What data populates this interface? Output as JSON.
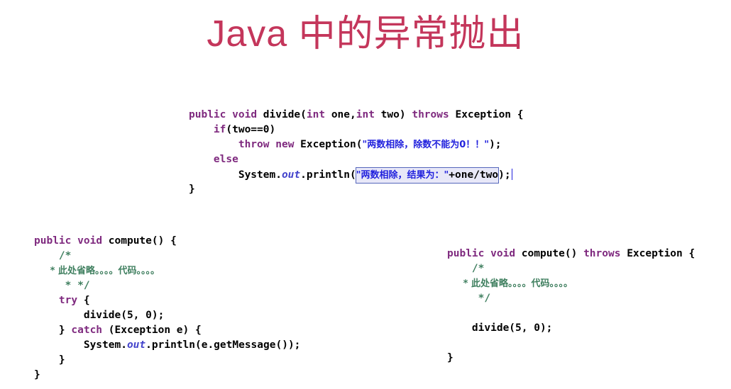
{
  "slide": {
    "title": "Java 中的异常抛出",
    "title_color": "#c4365b",
    "background_color": "#ffffff"
  },
  "theme": {
    "keyword_color": "#7f2a7f",
    "string_color": "#2222dd",
    "comment_color": "#3f7f5f",
    "field_color": "#4444cc",
    "plain_color": "#000000",
    "selection_fill": "#e8e8f8",
    "selection_border": "#5566bb"
  },
  "code_divide": {
    "name": "divide-method-snippet",
    "lines": [
      {
        "tokens": [
          {
            "t": "public",
            "k": "kw"
          },
          {
            "t": " ",
            "k": "plain"
          },
          {
            "t": "void",
            "k": "kw"
          },
          {
            "t": " divide(",
            "k": "plain"
          },
          {
            "t": "int",
            "k": "kw"
          },
          {
            "t": " one,",
            "k": "plain"
          },
          {
            "t": "int",
            "k": "kw"
          },
          {
            "t": " two) ",
            "k": "plain"
          },
          {
            "t": "throws",
            "k": "kw"
          },
          {
            "t": " Exception {",
            "k": "plain"
          }
        ]
      },
      {
        "tokens": [
          {
            "t": "    ",
            "k": "plain"
          },
          {
            "t": "if",
            "k": "kw"
          },
          {
            "t": "(two==0)",
            "k": "plain"
          }
        ]
      },
      {
        "tokens": [
          {
            "t": "        ",
            "k": "plain"
          },
          {
            "t": "throw",
            "k": "kw"
          },
          {
            "t": " ",
            "k": "plain"
          },
          {
            "t": "new",
            "k": "kw"
          },
          {
            "t": " Exception(",
            "k": "plain"
          },
          {
            "t": "\"两数相除，除数不能为0！！\"",
            "k": "str"
          },
          {
            "t": ");",
            "k": "plain"
          }
        ]
      },
      {
        "tokens": [
          {
            "t": "    ",
            "k": "plain"
          },
          {
            "t": "else",
            "k": "kw"
          }
        ]
      },
      {
        "tokens": [
          {
            "t": "        System.",
            "k": "plain"
          },
          {
            "t": "out",
            "k": "field"
          },
          {
            "t": ".println(",
            "k": "plain"
          },
          {
            "t": "\"两数相除，结果为：\"",
            "k": "str",
            "sel": "open"
          },
          {
            "t": "+one/two",
            "k": "plain",
            "sel": "close"
          },
          {
            "t": ");",
            "k": "plain"
          },
          {
            "t": "",
            "k": "caret"
          }
        ]
      },
      {
        "tokens": [
          {
            "t": "}",
            "k": "plain"
          }
        ]
      }
    ]
  },
  "code_compute_try": {
    "name": "compute-with-try-catch-snippet",
    "lines": [
      {
        "tokens": [
          {
            "t": "public",
            "k": "kw"
          },
          {
            "t": " ",
            "k": "plain"
          },
          {
            "t": "void",
            "k": "kw"
          },
          {
            "t": " compute() {",
            "k": "plain"
          }
        ]
      },
      {
        "tokens": [
          {
            "t": "    /*",
            "k": "cmt"
          }
        ]
      },
      {
        "tokens": [
          {
            "t": "     * 此处省略。。。。代码。。。。",
            "k": "cmt"
          }
        ]
      },
      {
        "tokens": [
          {
            "t": "     * */",
            "k": "cmt"
          }
        ]
      },
      {
        "tokens": [
          {
            "t": "    ",
            "k": "plain"
          },
          {
            "t": "try",
            "k": "kw"
          },
          {
            "t": " {",
            "k": "plain"
          }
        ]
      },
      {
        "tokens": [
          {
            "t": "        divide(5, 0);",
            "k": "plain"
          }
        ]
      },
      {
        "tokens": [
          {
            "t": "    } ",
            "k": "plain"
          },
          {
            "t": "catch",
            "k": "kw"
          },
          {
            "t": " (Exception e) {",
            "k": "plain"
          }
        ]
      },
      {
        "tokens": [
          {
            "t": "        System.",
            "k": "plain"
          },
          {
            "t": "out",
            "k": "field"
          },
          {
            "t": ".println(e.getMessage());",
            "k": "plain"
          }
        ]
      },
      {
        "tokens": [
          {
            "t": "    }",
            "k": "plain"
          }
        ]
      },
      {
        "tokens": [
          {
            "t": "}",
            "k": "plain"
          }
        ]
      }
    ]
  },
  "code_compute_throws": {
    "name": "compute-with-throws-snippet",
    "lines": [
      {
        "tokens": [
          {
            "t": "public",
            "k": "kw"
          },
          {
            "t": " ",
            "k": "plain"
          },
          {
            "t": "void",
            "k": "kw"
          },
          {
            "t": " compute() ",
            "k": "plain"
          },
          {
            "t": "throws",
            "k": "kw"
          },
          {
            "t": " Exception {",
            "k": "plain"
          }
        ]
      },
      {
        "tokens": [
          {
            "t": "    /*",
            "k": "cmt"
          }
        ]
      },
      {
        "tokens": [
          {
            "t": "     * 此处省略。。。。代码。。。。",
            "k": "cmt"
          }
        ]
      },
      {
        "tokens": [
          {
            "t": "     */",
            "k": "cmt"
          }
        ]
      },
      {
        "tokens": [
          {
            "t": "",
            "k": "plain"
          }
        ]
      },
      {
        "tokens": [
          {
            "t": "    divide(5, 0);",
            "k": "plain"
          }
        ]
      },
      {
        "tokens": [
          {
            "t": "",
            "k": "plain"
          }
        ]
      },
      {
        "tokens": [
          {
            "t": "}",
            "k": "plain"
          }
        ]
      }
    ]
  }
}
